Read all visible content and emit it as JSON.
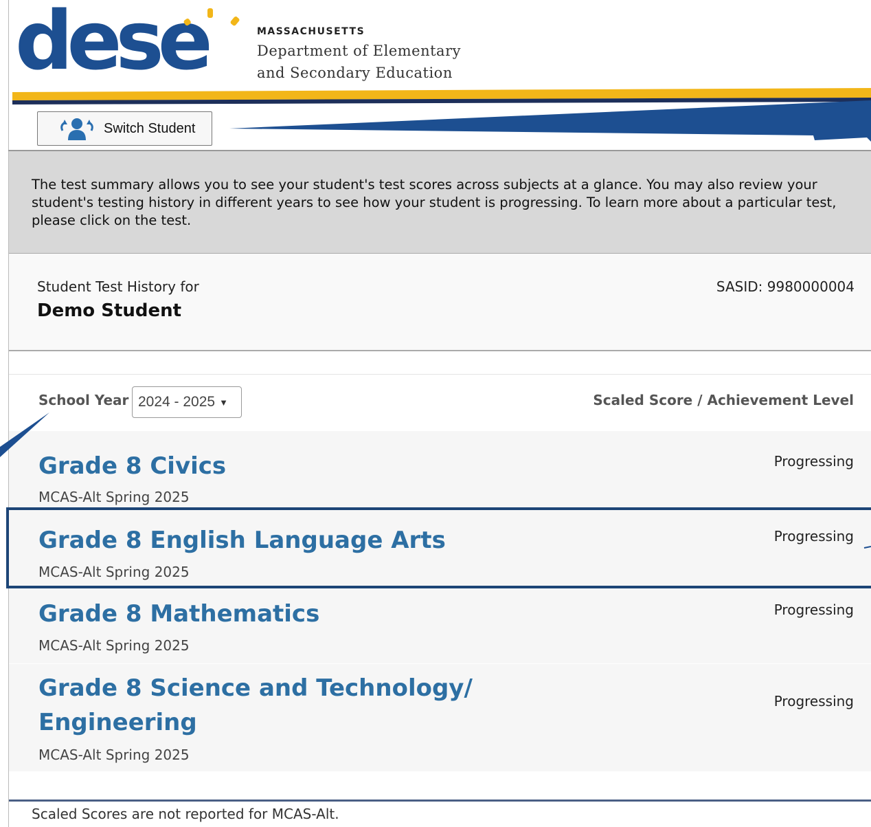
{
  "header": {
    "logo_text": "dese",
    "org_small": "MASSACHUSETTS",
    "org_line1": "Department of Elementary",
    "org_line2": "and Secondary Education"
  },
  "toolbar": {
    "switch_student_label": "Switch Student",
    "switch_student_icon": "switch-user-icon"
  },
  "intro": {
    "text": "The test summary allows you to see your student's test scores across subjects at a glance. You may also review your student's testing history in different years to see how your student is progressing. To learn more about a particular test, please click on the test."
  },
  "student": {
    "history_label": "Student Test History for",
    "name": "Demo Student",
    "sasid": "SASID: 9980000004"
  },
  "filter": {
    "year_label": "School Year",
    "year_value": "2024 - 2025",
    "score_header": "Scaled Score / Achievement Level"
  },
  "tests": [
    {
      "title": "Grade 8 Civics",
      "subtitle": "MCAS-Alt Spring 2025",
      "level": "Progressing"
    },
    {
      "title": "Grade 8 English Language Arts",
      "subtitle": "MCAS-Alt Spring 2025",
      "level": "Progressing"
    },
    {
      "title": "Grade 8 Mathematics",
      "subtitle": "MCAS-Alt Spring 2025",
      "level": "Progressing"
    },
    {
      "title_line1": "Grade 8 Science and Technology/",
      "title_line2": "Engineering",
      "subtitle": "MCAS-Alt Spring 2025",
      "level": "Progressing"
    }
  ],
  "footnote": "Scaled Scores are not reported for MCAS-Alt.",
  "colors": {
    "brand_blue": "#1d4f91",
    "brand_gold": "#f2b619",
    "link_blue": "#2d6fa3",
    "highlight_border": "#1d4577"
  }
}
